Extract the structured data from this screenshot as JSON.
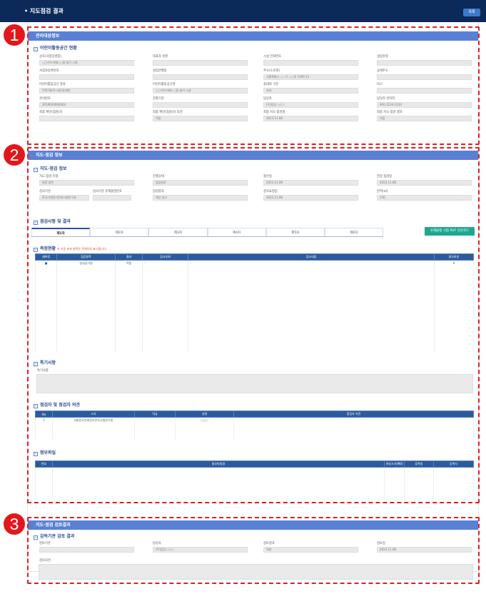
{
  "header": {
    "title": "• 지도점검 결과",
    "list_btn": "목록"
  },
  "badges": [
    "1",
    "2",
    "3"
  ],
  "section1": {
    "title": "관리대상정보",
    "sub": "어린이활동공간 현황",
    "fields": [
      {
        "label": "상호(사업장명칭)",
        "value": "○○키즈카페○○점 놀이 시설"
      },
      {
        "label": "대표자 성명",
        "value": ""
      },
      {
        "label": "시설 전화번호",
        "value": ""
      },
      {
        "label": "설립유형",
        "value": ""
      },
      {
        "label": "사업자등록번호",
        "value": ""
      },
      {
        "label": "설립연월일",
        "value": ""
      },
      {
        "label": "주소(도로명)",
        "value": "서울특별시 ○○구 ○○로 1000-11"
      },
      {
        "label": "상세주소",
        "value": ""
      },
      {
        "label": "어린이활동공간 종류",
        "value": "어린이놀이시설(실내형)"
      },
      {
        "label": "어린이활동공간명",
        "value": "○○키즈카페○○점 놀이 시설"
      },
      {
        "label": "실내외 구분",
        "value": "실내"
      },
      {
        "label": "비고",
        "value": ""
      },
      {
        "label": "관리번호",
        "value": "2019020000004"
      },
      {
        "label": "관할기관",
        "value": ""
      },
      {
        "label": "담당자",
        "value": "(주)담당 ○○○"
      },
      {
        "label": "담당자 연락처",
        "value": "000-1234-1234"
      },
      {
        "label": "최종 확인(점검)자",
        "value": ""
      },
      {
        "label": "최종 확인(점검)자 의견",
        "value": "적합"
      },
      {
        "label": "최종 지도·점검일",
        "value": "2023.11.08"
      },
      {
        "label": "최종 지도·점검 결과",
        "value": "적합"
      }
    ]
  },
  "section2": {
    "title": "지도·점검 정보",
    "sub": "지도·점검 정보",
    "fields": [
      {
        "label": "지도·점검 유형",
        "value": "현장 방문"
      },
      {
        "label": "진행상태",
        "value": "점검완료"
      },
      {
        "label": "접수일",
        "value": "2023.11.08"
      },
      {
        "label": "현장 점검일",
        "value": "2023.11.08"
      },
      {
        "label": "검사기관",
        "value": "한국기계전기전자시험연구원"
      },
      {
        "label": "검사기관 유해물질번호",
        "value": ""
      },
      {
        "label": "점검결과",
        "value": "개선 권고"
      },
      {
        "label": "검사요청일",
        "value": "2023.11.08"
      },
      {
        "label": "면적(㎡)",
        "value": "130"
      }
    ],
    "results_title": "점검사항 및 결과",
    "tabs": [
      "제1차",
      "제2차",
      "제3차",
      "제4차",
      "제5차",
      "제6차"
    ],
    "pdf_btn": "유해물질 시험 PDF 다운로드",
    "status_title": "측정현황",
    "status_note": "※ 기준 초과 항목은 적색으로 표시됩니다.",
    "status_headers": [
      "재측정",
      "점검항목",
      "결과",
      "검사부위",
      "검사내용",
      "첨부파일"
    ],
    "status_rows": [
      {
        "check": "■",
        "item": "실내공기질",
        "result": "적합",
        "part": "-",
        "content": "-",
        "file": "0"
      }
    ],
    "special_title": "특기사항",
    "special_label": "특기사항",
    "inspector_title": "점검자 및 점검자 의견",
    "inspector_headers": [
      "No",
      "소속",
      "직급",
      "성명",
      "점검자 의견"
    ],
    "inspector_rows": [
      {
        "no": "1",
        "org": "(재)한국기계전기전자시험연구원",
        "rank": "",
        "name": "○○○",
        "opinion": ""
      }
    ],
    "attach_title": "첨부파일",
    "attach_headers": [
      "번호",
      "첨부파일명",
      "파일크기(MB)",
      "등록일",
      "등록자"
    ]
  },
  "section3": {
    "title": "지도·점검 검토결과",
    "sub": "감독기관 검토 결과",
    "fields": [
      {
        "label": "검토기관",
        "value": ""
      },
      {
        "label": "담당자",
        "value": "(주)담당 ○○○"
      },
      {
        "label": "검토결과",
        "value": "적합"
      },
      {
        "label": "검토일",
        "value": "2023.11.08"
      }
    ],
    "opinion_label": "검토의견"
  },
  "colors": {
    "topbar": "#0b2a59",
    "section_bar": "#5a80d6",
    "dash": "#e02020",
    "table_header": "#2b5b9a",
    "pdf_button": "#1ea78f"
  }
}
